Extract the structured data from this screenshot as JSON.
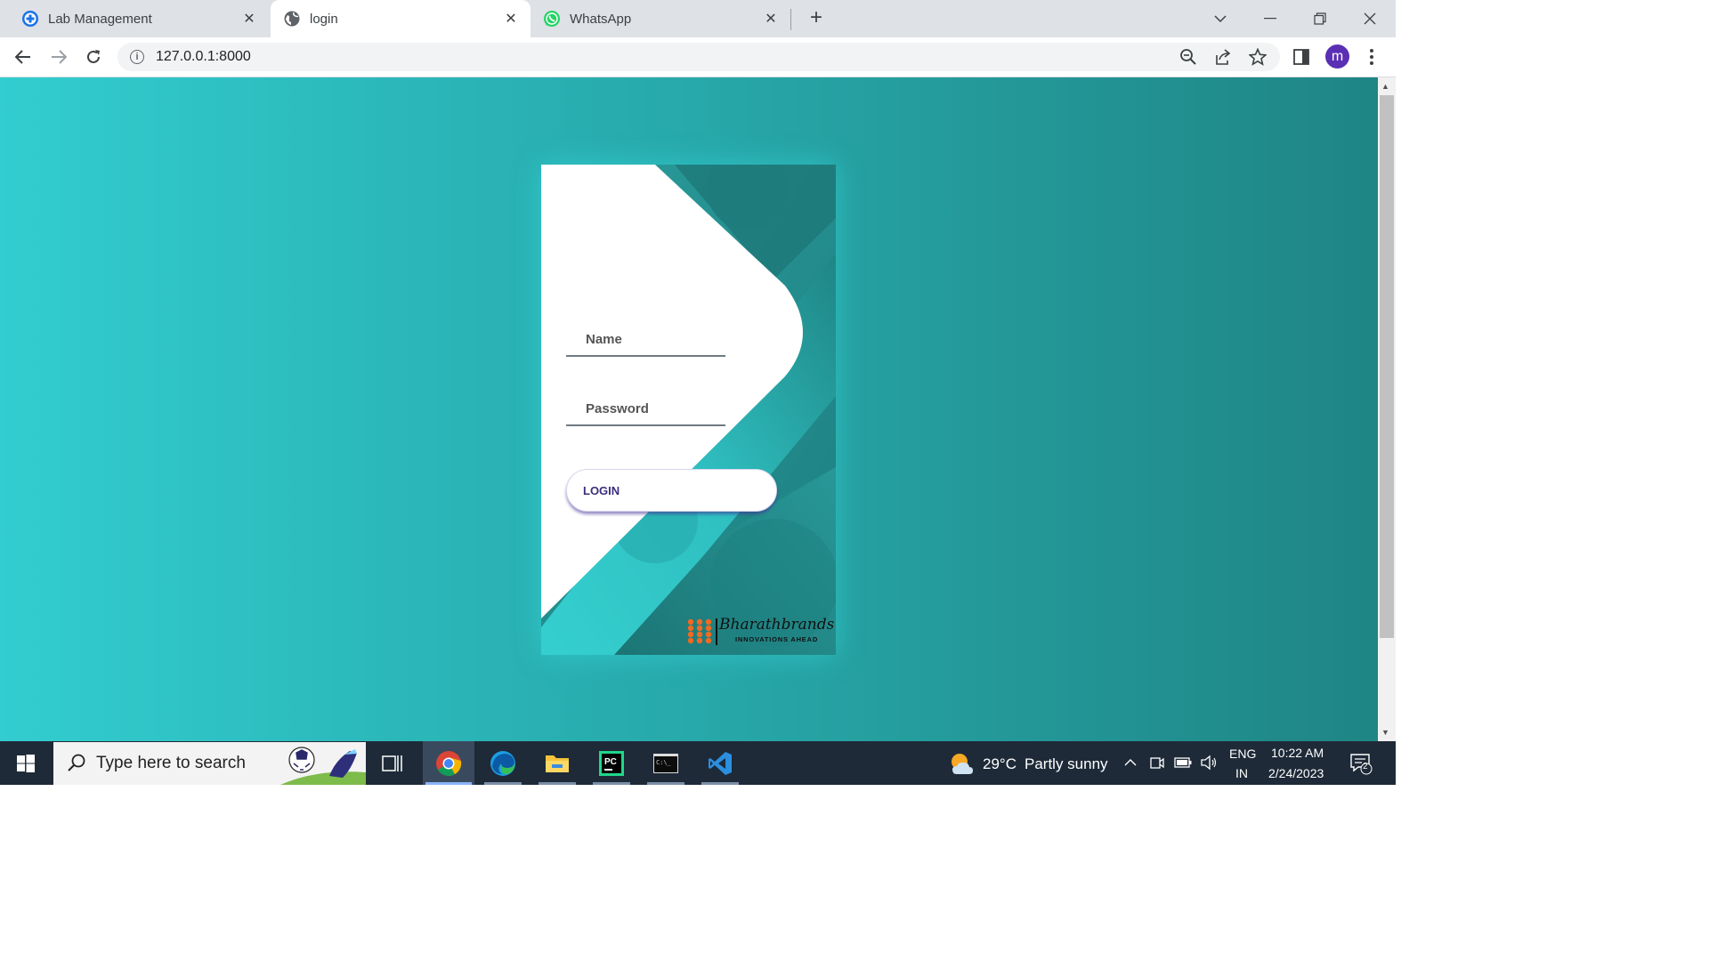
{
  "browser": {
    "tabs": [
      {
        "title": "Lab Management",
        "icon": "plus-circle-icon",
        "active": false
      },
      {
        "title": "login",
        "icon": "globe-icon",
        "active": true
      },
      {
        "title": "WhatsApp",
        "icon": "whatsapp-icon",
        "active": false
      }
    ],
    "url": "127.0.0.1:8000",
    "profile_initial": "m"
  },
  "page": {
    "name_placeholder": "Name",
    "password_placeholder": "Password",
    "login_label": "LOGIN",
    "brand_name": "Bharathbrands",
    "brand_tagline": "INNOVATIONS AHEAD"
  },
  "taskbar": {
    "search_placeholder": "Type here to search",
    "weather_temp": "29°C",
    "weather_text": "Partly sunny",
    "language_top": "ENG",
    "language_bottom": "IN",
    "time": "10:22 AM",
    "date": "2/24/2023",
    "notification_count": "2"
  },
  "colors": {
    "background_start": "#32cdd0",
    "background_end": "#1f8585",
    "login_text": "#3b2e7e",
    "avatar": "#5b2fb3"
  }
}
